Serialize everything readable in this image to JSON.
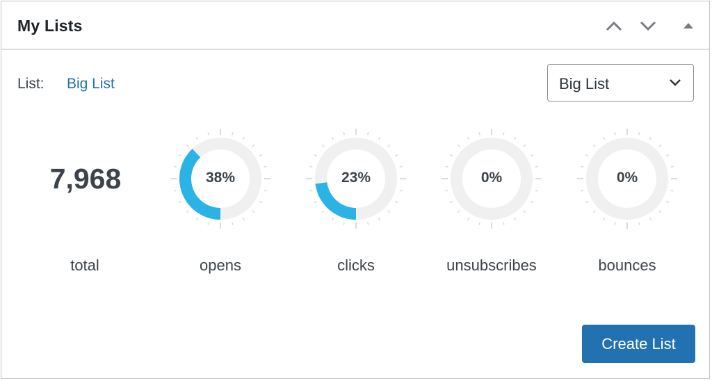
{
  "widget": {
    "title": "My Lists",
    "controls": [
      {
        "name": "move-up-button",
        "icon": "chevron-up-icon"
      },
      {
        "name": "move-down-button",
        "icon": "chevron-down-icon"
      },
      {
        "name": "toggle-panel-button",
        "icon": "triangle-up-icon"
      }
    ]
  },
  "list_selector": {
    "label": "List:",
    "current_link": "Big List",
    "selected_option": "Big List"
  },
  "stats": {
    "total": {
      "value": "7,968",
      "label": "total"
    },
    "rates": [
      {
        "key": "opens",
        "label": "opens",
        "percent": 38,
        "display": "38%"
      },
      {
        "key": "clicks",
        "label": "clicks",
        "percent": 23,
        "display": "23%"
      },
      {
        "key": "unsubscribes",
        "label": "unsubscribes",
        "percent": 0,
        "display": "0%"
      },
      {
        "key": "bounces",
        "label": "bounces",
        "percent": 0,
        "display": "0%"
      }
    ]
  },
  "colors": {
    "accent_fill": "#2bb3e6",
    "track": "#f0f0f1",
    "tick": "#dcdcde",
    "primary_button": "#2271b1",
    "link": "#2271b1"
  },
  "actions": {
    "create_list_label": "Create List"
  }
}
